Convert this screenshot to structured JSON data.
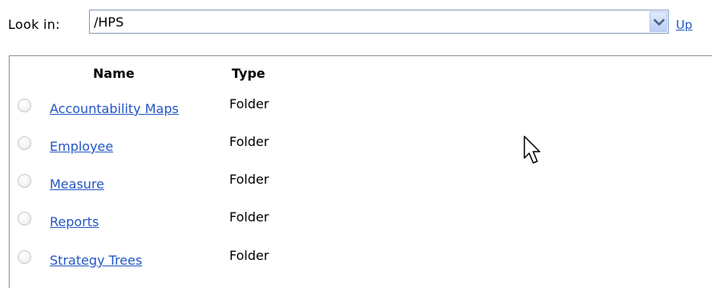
{
  "look_in": {
    "label": "Look in:",
    "path": "/HPS",
    "up_label": "Up"
  },
  "table": {
    "headers": {
      "name": "Name",
      "type": "Type"
    },
    "rows": [
      {
        "name": "Accountability Maps",
        "type": "Folder"
      },
      {
        "name": "Employee",
        "type": "Folder"
      },
      {
        "name": "Measure",
        "type": "Folder"
      },
      {
        "name": "Reports",
        "type": "Folder"
      },
      {
        "name": "Strategy Trees",
        "type": "Folder"
      }
    ]
  },
  "icons": {
    "dropdown": "chevron-down-icon",
    "cursor": "mouse-pointer-icon",
    "row_selector": "radio-button"
  },
  "colors": {
    "link": "#2357c5",
    "select_border": "#7f9db9",
    "dropdown_fill": "#b9cdf6"
  }
}
